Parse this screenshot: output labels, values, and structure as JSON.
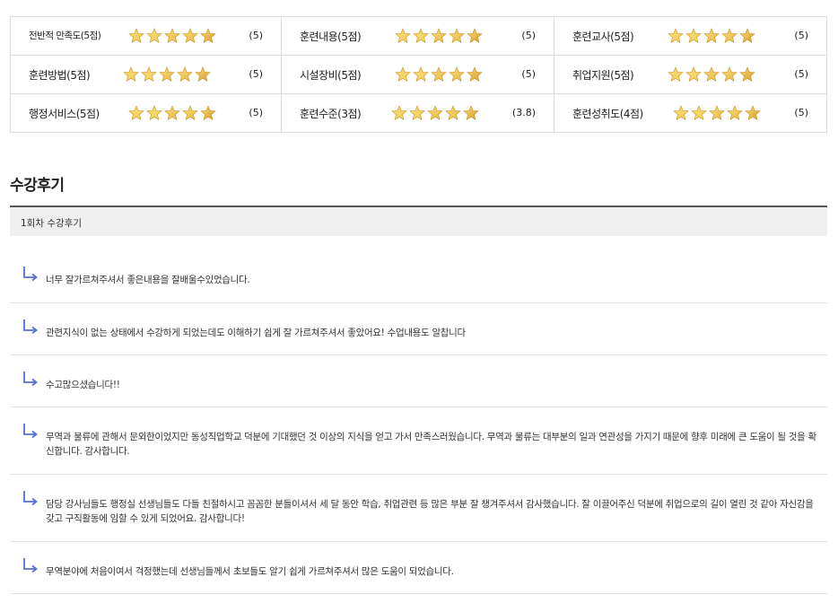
{
  "ratings": [
    {
      "label": "전반적 만족도(5점)",
      "score": "(5)",
      "stars": 5
    },
    {
      "label": "훈련내용(5점)",
      "score": "(5)",
      "stars": 5
    },
    {
      "label": "훈련교사(5점)",
      "score": "(5)",
      "stars": 5
    },
    {
      "label": "훈련방법(5점)",
      "score": "(5)",
      "stars": 5
    },
    {
      "label": "시설장비(5점)",
      "score": "(5)",
      "stars": 5
    },
    {
      "label": "취업지원(5점)",
      "score": "(5)",
      "stars": 5
    },
    {
      "label": "행정서비스(5점)",
      "score": "(5)",
      "stars": 5
    },
    {
      "label": "훈련수준(3점)",
      "score": "(3.8)",
      "stars": 5
    },
    {
      "label": "훈련성취도(4점)",
      "score": "(5)",
      "stars": 5
    }
  ],
  "colors": {
    "star_light": "#f3cf5a",
    "star_dark": "#d99a2c",
    "arrow": "#5a6fd0"
  },
  "section_title": "수강후기",
  "review_header": "1회차 수강후기",
  "reviews": [
    {
      "text": "너무 잘가르쳐주셔서 좋은내용을 잘배울수있었습니다."
    },
    {
      "text": "관련지식이 없는 상태에서 수강하게 되었는데도 이해하기 쉽게 잘 가르쳐주셔서 좋았어요! 수업내용도 알찹니다"
    },
    {
      "text": "수고많으셨습니다!!"
    },
    {
      "text": "무역과 물류에 관해서 문외한이었지만 동성직업학교 덕분에 기대했던 것 이상의 지식을 얻고 가서 만족스러웠습니다. 무역과 물류는 대부분의 일과 연관성을 가지기 때문에 향후 미래에 큰 도움이 될 것을 확신합니다. 감사합니다."
    },
    {
      "text": "담당 강사님들도 행정실 선생님들도 다들 친절하시고 꼼꼼한 분들이셔서 세 달 동안 학습, 취업관련 등 많은 부분 잘 챙겨주셔서 감사했습니다. 잘 이끌어주신 덕분에 취업으로의 길이 열린 것 같아 자신감을 갖고 구직활동에 임할 수 있게 되었어요. 감사합니다!"
    },
    {
      "text": "무역분야에 처음이여서 걱정했는데 선생님들께서 초보들도 알기 쉽게 가르쳐주셔서 많은 도움이 되었습니다."
    }
  ]
}
